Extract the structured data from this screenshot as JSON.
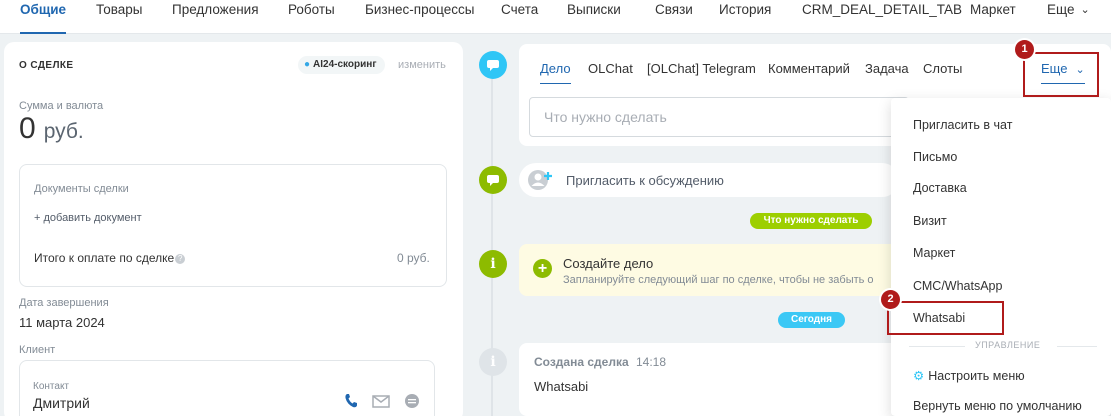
{
  "topnav": {
    "tabs": [
      "Общие",
      "Товары",
      "Предложения",
      "Роботы",
      "Бизнес-процессы",
      "Счета",
      "Выписки",
      "Связи",
      "История",
      "CRM_DEAL_DETAIL_TAB",
      "Маркет",
      "Еще"
    ],
    "active_tab": "Общие"
  },
  "deal": {
    "section_title": "О СДЕЛКЕ",
    "ai_scoring": "AI24-скоринг",
    "change_link": "изменить",
    "sum_label": "Сумма и валюта",
    "sum_value": "0",
    "sum_currency": "руб.",
    "documents_label": "Документы сделки",
    "add_document": "+ добавить документ",
    "total_label": "Итого к оплате по сделке",
    "total_value": "0 руб.",
    "close_date_label": "Дата завершения",
    "close_date_value": "11 марта 2024",
    "client_label": "Клиент",
    "contact_label": "Контакт",
    "contact_name": "Дмитрий"
  },
  "editor": {
    "tabs": [
      "Дело",
      "OLChat",
      "[OLChat] Telegram",
      "Комментарий",
      "Задача",
      "Слоты"
    ],
    "active_tab": "Дело",
    "more_label": "Еще",
    "placeholder": "Что нужно сделать"
  },
  "timeline": {
    "invite_text": "Пригласить к обсуждению",
    "todo_pill": "Что нужно сделать",
    "task_title": "Создайте дело",
    "task_hint": "Запланируйте следующий шаг по сделке, чтобы не забыть о",
    "today_pill": "Сегодня",
    "created_title": "Создана сделка",
    "created_time": "14:18",
    "created_text": "Whatsabi"
  },
  "menu": {
    "items": [
      "Пригласить в чат",
      "Письмо",
      "Доставка",
      "Визит",
      "Маркет",
      "СМС/WhatsApp",
      "Whatsabi"
    ],
    "section_label": "УПРАВЛЕНИЕ",
    "settings_item": "Настроить меню",
    "reset_item": "Вернуть меню по умолчанию"
  },
  "annotations": {
    "badge1": "1",
    "badge2": "2"
  },
  "colors": {
    "accent": "#2067b0",
    "green": "#8dbb00",
    "blue_pill": "#35bdf0",
    "highlight": "#b01b1b"
  }
}
